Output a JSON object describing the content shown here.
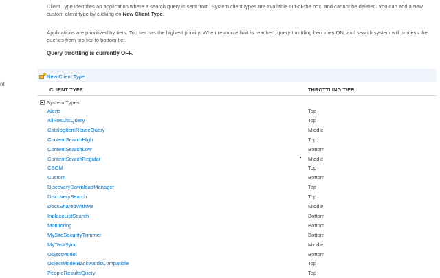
{
  "left_nav": {
    "fragment": "nt"
  },
  "description": {
    "para1_pre": "Client Type identifies an application where a search query is sent from. System client types are available out-of-the box, and cannot be deleted. You can add a new custom client type by clicking on ",
    "para1_bold": "New Client Type",
    "para1_post": ".",
    "para2": "Applications are prioritized by tiers. Top tier has the highest priority. When resource limit is reached, query throttling becomes ON, and search system will process the queries from top tier to bottom tier.",
    "status": "Query throttling is currently OFF."
  },
  "toolbar": {
    "new_client_type_label": "New Client Type",
    "icon": "new-item-icon"
  },
  "table": {
    "headers": {
      "client_type": "CLIENT TYPE",
      "throttling_tier": "THROTTLING TIER"
    },
    "group_label": "System Types",
    "rows": [
      {
        "name": "Alerts",
        "tier": "Top"
      },
      {
        "name": "AllResultsQuery",
        "tier": "Top"
      },
      {
        "name": "CatalogItemReuseQuery",
        "tier": "Middle"
      },
      {
        "name": "ContentSearchHigh",
        "tier": "Top"
      },
      {
        "name": "ContentSearchLow",
        "tier": "Bottom"
      },
      {
        "name": "ContentSearchRegular",
        "tier": "Middle"
      },
      {
        "name": "CSOM",
        "tier": "Top"
      },
      {
        "name": "Custom",
        "tier": "Bottom"
      },
      {
        "name": "DiscoveryDownloadManager",
        "tier": "Top"
      },
      {
        "name": "DiscoverySearch",
        "tier": "Top"
      },
      {
        "name": "DocsSharedWithMe",
        "tier": "Middle"
      },
      {
        "name": "InplaceListSearch",
        "tier": "Bottom"
      },
      {
        "name": "Monitoring",
        "tier": "Bottom"
      },
      {
        "name": "MySiteSecurityTrimmer",
        "tier": "Bottom"
      },
      {
        "name": "MyTaskSync",
        "tier": "Middle"
      },
      {
        "name": "ObjectModel",
        "tier": "Bottom"
      },
      {
        "name": "ObjectModelBackwardsCompatible",
        "tier": "Top"
      },
      {
        "name": "PeopleResultsQuery",
        "tier": "Top"
      }
    ]
  },
  "colors": {
    "link": "#0072c6",
    "toolbar_bg": "#f0f5fb",
    "text": "#444444"
  }
}
